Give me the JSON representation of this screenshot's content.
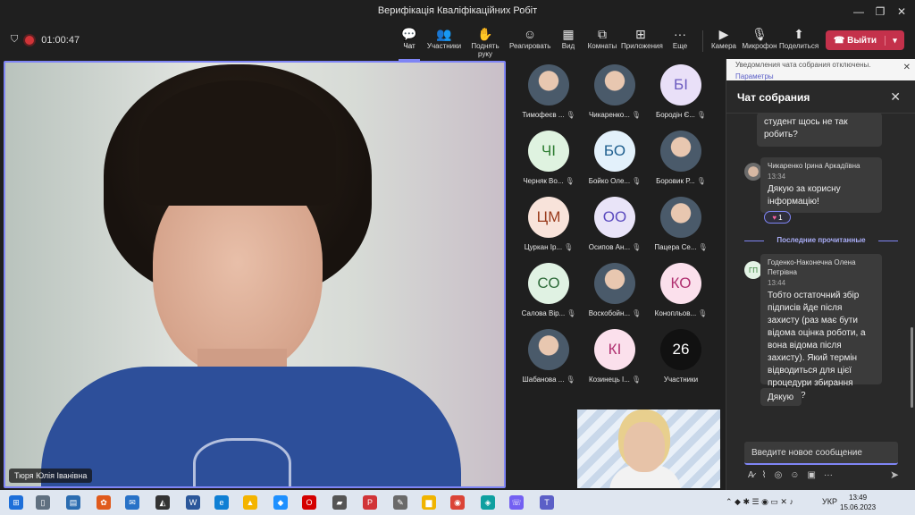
{
  "window": {
    "title": "Верифікація Кваліфікаційних Робіт",
    "controls": {
      "minimize": "—",
      "maximize": "❐",
      "close": "✕"
    }
  },
  "toolbar": {
    "timer": "01:00:47",
    "buttons": [
      {
        "label": "Чат",
        "icon": "chat-icon",
        "glyph": "💬"
      },
      {
        "label": "Участники",
        "icon": "people-icon",
        "glyph": "👥"
      },
      {
        "label": "Поднять руку",
        "icon": "hand-icon",
        "glyph": "✋"
      },
      {
        "label": "Реагировать",
        "icon": "smile-icon",
        "glyph": "☺"
      },
      {
        "label": "Вид",
        "icon": "grid-icon",
        "glyph": "▦"
      },
      {
        "label": "Комнаты",
        "icon": "rooms-icon",
        "glyph": "⧉"
      },
      {
        "label": "Приложения",
        "icon": "plus-icon",
        "glyph": "⊞"
      },
      {
        "label": "Еще",
        "icon": "more-icon",
        "glyph": "···"
      },
      {
        "label": "Камера",
        "icon": "camera-icon",
        "glyph": "▶"
      },
      {
        "label": "Микрофон",
        "icon": "mic-off-icon",
        "glyph": "🎙"
      },
      {
        "label": "Поделиться",
        "icon": "share-icon",
        "glyph": "⬆"
      }
    ],
    "leave_label": "Выйти",
    "leave_color": "#c4314b",
    "accent": "#7f85f5"
  },
  "stage": {
    "speaker_name": "Тюря Юлія Іванівна"
  },
  "participants": [
    {
      "name": "Тимофеєв ...",
      "initials": "",
      "color": "",
      "photo": true
    },
    {
      "name": "Чикаренко...",
      "initials": "",
      "color": "",
      "photo": true
    },
    {
      "name": "Бородін Є...",
      "initials": "БІ",
      "color": "#e9e0f8",
      "text": "#6b5bbf"
    },
    {
      "name": "Черняк Во...",
      "initials": "ЧІ",
      "color": "#dff3e0",
      "text": "#2e7d32"
    },
    {
      "name": "Бойко Оле...",
      "initials": "БО",
      "color": "#e3f1fb",
      "text": "#1e5e8e"
    },
    {
      "name": "Боровик Р...",
      "initials": "",
      "color": "",
      "photo": true
    },
    {
      "name": "Цуркан Ір...",
      "initials": "ЦМ",
      "color": "#f8e3da",
      "text": "#9a3b1c"
    },
    {
      "name": "Осипов Ан...",
      "initials": "ОО",
      "color": "#e9e4f8",
      "text": "#5b4bbf"
    },
    {
      "name": "Пацера Се...",
      "initials": "",
      "color": "",
      "photo": true
    },
    {
      "name": "Салова Вір...",
      "initials": "СО",
      "color": "#e0f2e3",
      "text": "#2e6b3a"
    },
    {
      "name": "Воскобойн...",
      "initials": "",
      "color": "",
      "photo": true
    },
    {
      "name": "Конопльов...",
      "initials": "КО",
      "color": "#fbe0ec",
      "text": "#b03070"
    },
    {
      "name": "Шабанова ...",
      "initials": "",
      "color": "",
      "photo": true
    },
    {
      "name": "Козинець І...",
      "initials": "КІ",
      "color": "#fbe0ec",
      "text": "#b03070"
    },
    {
      "name": "Участники",
      "initials": "26",
      "color": "#111111",
      "text": "#ffffff"
    }
  ],
  "chat": {
    "notice": "Уведомления чата собрания отключены.",
    "notice_link": "Параметры",
    "title": "Чат собрания",
    "messages": [
      {
        "author": "",
        "time": "",
        "text": "студент щось не так робить?"
      },
      {
        "author": "Чикаренко Ірина Аркадіївна",
        "time": "13:34",
        "text": "Дякую за корисну інформацію!",
        "reaction": "1"
      },
      {
        "author": "Годенко-Наконечна Олена Петрівна",
        "initials": "ГП",
        "time": "13:44",
        "text": "Тобто остаточний збір підписів йде після захисту (раз має бути відома оцінка роботи, а вона відома після захисту). Який термін відводиться для цієї процедури збирання підписів?"
      },
      {
        "author": "",
        "time": "",
        "text": "Дякую"
      }
    ],
    "last_read": "Последние прочитанные",
    "compose_placeholder": "Введите новое сообщение"
  },
  "taskbar": {
    "language": "УКР",
    "time": "13:49",
    "date": "15.06.2023"
  }
}
